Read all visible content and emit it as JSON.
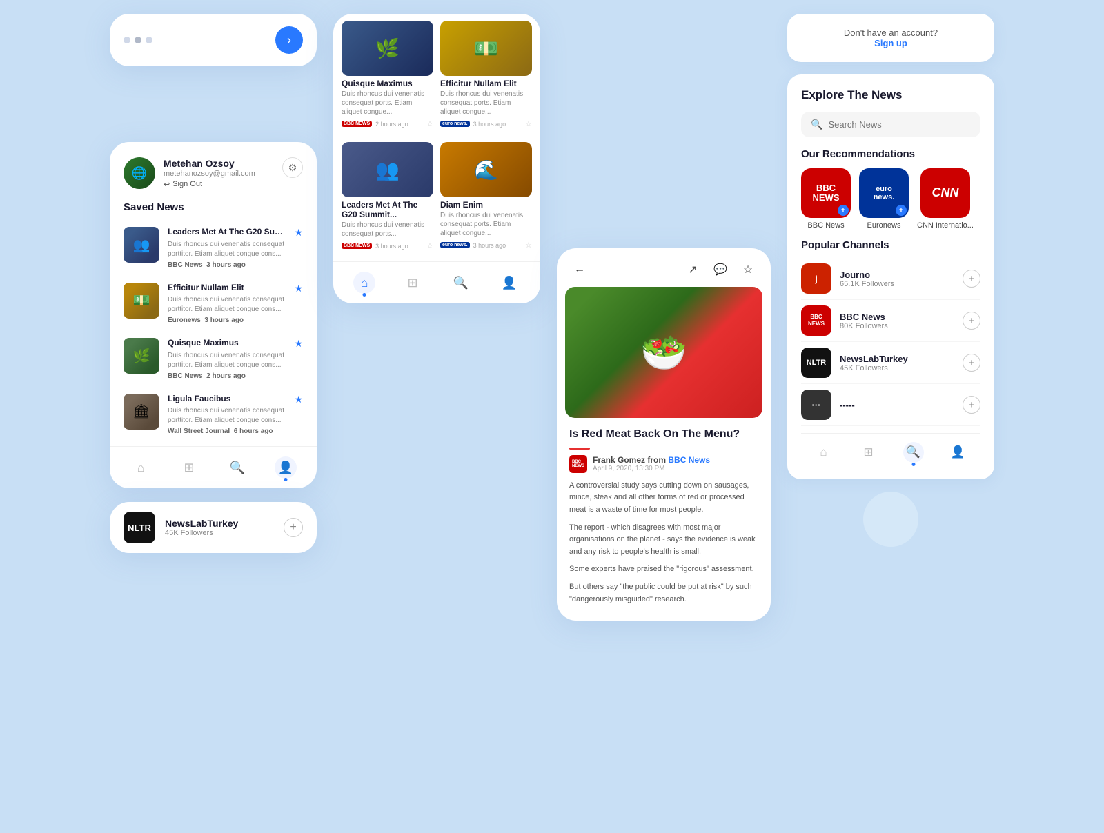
{
  "colors": {
    "accent": "#2979ff",
    "red": "#cc0000",
    "dark": "#1a1a2e",
    "bg": "#c8dff5"
  },
  "card_partial": {
    "dots": 3,
    "arrow_label": "›"
  },
  "profile_card": {
    "user_name": "Metehan Ozsoy",
    "user_email": "metehanozsoy@gmail.com",
    "signout_label": "Sign Out",
    "saved_news_label": "Saved News",
    "news_items": [
      {
        "title": "Leaders Met At The G20 Summit...",
        "desc": "Duis rhoncus dui venenatis consequat porttitor. Etiam aliquet congue cons...",
        "source": "BBC News",
        "time": "3 hours ago",
        "thumb_type": "politicians",
        "starred": true
      },
      {
        "title": "Efficitur Nullam Elit",
        "desc": "Duis rhoncus dui venenatis consequat porttitor. Etiam aliquet congue cons...",
        "source": "Euronews",
        "time": "3 hours ago",
        "thumb_type": "money",
        "starred": true
      },
      {
        "title": "Quisque Maximus",
        "desc": "Duis rhoncus dui venenatis consequat porttitor. Etiam aliquet congue cons...",
        "source": "BBC News",
        "time": "2 hours ago",
        "thumb_type": "nature",
        "starred": true
      },
      {
        "title": "Ligula Faucibus",
        "desc": "Duis rhoncus dui venenatis consequat porttitor. Etiam aliquet congue cons...",
        "source": "Wall Street Journal",
        "time": "6 hours ago",
        "thumb_type": "building",
        "starred": true
      }
    ],
    "nav_items": [
      "home",
      "grid",
      "search",
      "profile"
    ],
    "active_nav": "profile"
  },
  "channel_card": {
    "channel_name": "NewsLabTurkey",
    "channel_followers": "45K Followers"
  },
  "feed_card": {
    "feed_items": [
      {
        "title": "Quisque Maximus",
        "desc": "Duis rhoncus dui venenatis consequat ports. Etiam aliquet congue...",
        "source_type": "bbc",
        "source_name": "BBC News",
        "time": "2 hours ago",
        "img_type": "nature"
      },
      {
        "title": "Efficitur Nullam Elit",
        "desc": "Duis rhoncus dui venenatis consequat ports. Etiam aliquet congue...",
        "source_type": "euro",
        "source_name": "Euronews",
        "time": "3 hours ago",
        "img_type": "money"
      },
      {
        "title": "Leaders Met At The G20 Summit...",
        "desc": "Duis rhoncus dui venenatis consequat ports...",
        "source_type": "bbc",
        "source_name": "BBC News",
        "time": "3 hours ago",
        "img_type": "politicians2"
      },
      {
        "title": "Diam Enim",
        "desc": "Duis rhoncus dui venenatis consequat ports. Etiam aliquet congue...",
        "source_type": "euro",
        "source_name": "Euronews",
        "time": "3 hours ago",
        "img_type": "waterfall"
      }
    ],
    "nav_items": [
      "home",
      "grid",
      "search",
      "profile"
    ],
    "active_nav": "home"
  },
  "article_card": {
    "title": "Is Red Meat Back On The Menu?",
    "author": "Frank Gomez",
    "source": "BBC News",
    "date": "April 9, 2020, 13:30 PM",
    "body": [
      "A controversial study says cutting down on sausages, mince, steak and all other forms of red or processed meat is a waste of time for most people.",
      "The report - which disagrees with most major organisations on the planet - says the evidence is weak and any risk to people's health is small.",
      "Some experts have praised the \"rigorous\" assessment.",
      "But others say \"the public could be put at risk\" by such \"dangerously misguided\" research."
    ]
  },
  "right_panel": {
    "signup_text": "Don't have an account?",
    "signup_link": "Sign up",
    "explore_title": "Explore The News",
    "search_placeholder": "Search News",
    "recommendations_title": "Our Recommendations",
    "channels": [
      {
        "name": "BBC News",
        "type": "bbc"
      },
      {
        "name": "Euronews",
        "type": "euro"
      },
      {
        "name": "CNN Internatio...",
        "type": "cnn"
      }
    ],
    "popular_title": "Popular Channels",
    "popular_channels": [
      {
        "name": "Journo",
        "followers": "65.1K Followers",
        "type": "journo"
      },
      {
        "name": "BBC News",
        "followers": "80K Followers",
        "type": "bbc"
      },
      {
        "name": "NewsLabTurkey",
        "followers": "45K Followers",
        "type": "nltr"
      },
      {
        "name": "-----",
        "followers": "",
        "type": "extra"
      }
    ],
    "nav_items": [
      "home",
      "grid",
      "search",
      "profile"
    ],
    "active_nav": "search"
  }
}
